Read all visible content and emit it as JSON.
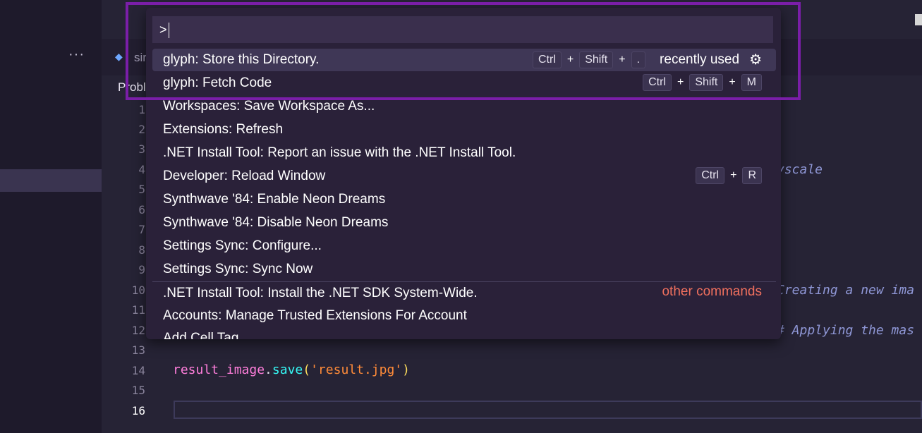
{
  "workbench": {
    "overflow_glyph": "···",
    "tab_icon": "python-icon",
    "tab_label": "sir",
    "panel_label": "Proble",
    "colors": {
      "highlight": "#7a1ea8",
      "other_commands": "#f0705e"
    }
  },
  "editor": {
    "line_numbers": [
      "1",
      "2",
      "3",
      "4",
      "5",
      "6",
      "7",
      "8",
      "9",
      "10",
      "11",
      "12",
      "13",
      "14",
      "15",
      "16"
    ],
    "active_line": "16",
    "visible_fragments": {
      "line4": "yscale",
      "line10": "Creating a new ima",
      "line12": "# Applying the mas"
    },
    "line14_tokens": [
      "result_image",
      ".",
      "save",
      "(",
      "'result.jpg'",
      ")"
    ]
  },
  "palette": {
    "input_value": ">",
    "items": [
      {
        "label": "glyph: Store this Directory.",
        "keys": [
          "Ctrl",
          "Shift",
          "."
        ],
        "badge": "recently used",
        "icon": "gear-icon"
      },
      {
        "label": "glyph: Fetch Code",
        "keys": [
          "Ctrl",
          "Shift",
          "M"
        ]
      },
      {
        "label": "Workspaces: Save Workspace As..."
      },
      {
        "label": "Extensions: Refresh"
      },
      {
        "label": ".NET Install Tool: Report an issue with the .NET Install Tool."
      },
      {
        "label": "Developer: Reload Window",
        "keys": [
          "Ctrl",
          "R"
        ]
      },
      {
        "label": "Synthwave '84: Enable Neon Dreams"
      },
      {
        "label": "Synthwave '84: Disable Neon Dreams"
      },
      {
        "label": "Settings Sync: Configure..."
      },
      {
        "label": "Settings Sync: Sync Now"
      },
      {
        "label": ".NET Install Tool: Install the .NET SDK System-Wide.",
        "badge": "other commands"
      },
      {
        "label": "Accounts: Manage Trusted Extensions For Account"
      },
      {
        "label": "Add Cell Tag"
      }
    ],
    "plus_sign": "+"
  }
}
